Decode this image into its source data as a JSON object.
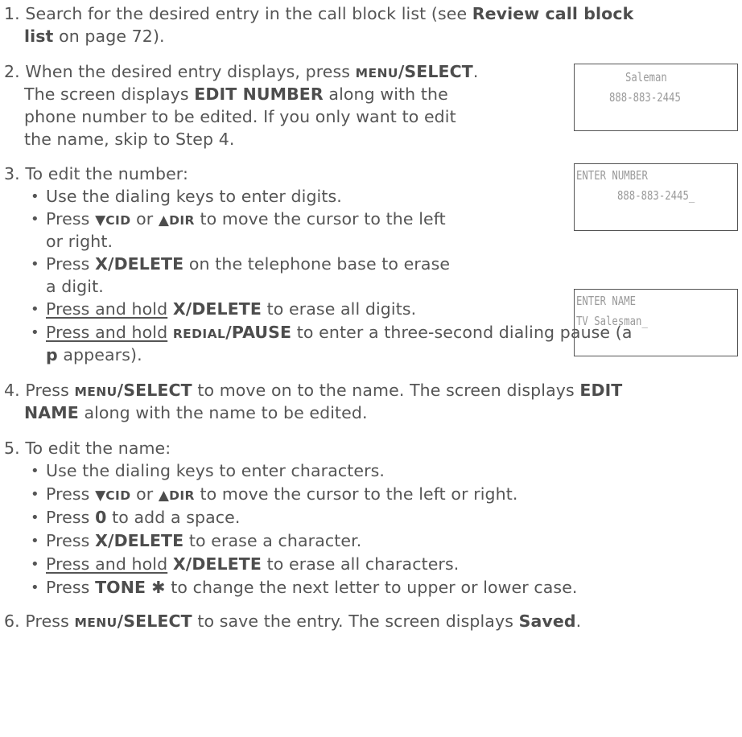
{
  "steps": {
    "s1": {
      "num": "1.",
      "l1a": "Search for the desired entry in the call block list (see ",
      "l1b": "Review call block",
      "l2a": "list",
      "l2b": " on page 72)."
    },
    "s2": {
      "num": "2.",
      "l1a": "When the desired entry displays, press ",
      "key": "MENU",
      "l1b": "/SELECT",
      "l1c": ".",
      "l2": "The screen displays ",
      "l2b": "EDIT NUMBER",
      "l2c": " along with the",
      "l3": "phone number to be edited. If you only want to edit",
      "l4": "the name, skip to Step 4."
    },
    "s3": {
      "num": "3.",
      "intro": "To edit the number:",
      "b1": "Use the dialing keys to enter digits.",
      "b2a": "Press ",
      "b2_down": "▼",
      "b2_cid": "CID",
      "b2_or": " or ",
      "b2_up": "▲",
      "b2_dir": "DIR",
      "b2b": " to move the cursor to the left",
      "b2c": "or right.",
      "b3a": "Press ",
      "b3b": "X/DELETE",
      "b3c": " on the telephone base to erase",
      "b3d": "a digit.",
      "b4a": "Press and hold",
      "b4b": " ",
      "b4c": "X/DELETE",
      "b4d": " to erase all digits.",
      "b5a": "Press and hold",
      "b5b": " ",
      "b5c": "REDIAL",
      "b5d": "/PAUSE",
      "b5e": " to enter a three-second dialing pause (a",
      "b5f": "p",
      "b5g": " appears)."
    },
    "s4": {
      "num": "4.",
      "l1a": "Press ",
      "key": "MENU",
      "l1b": "/SELECT",
      "l1c": " to move on to the name. The screen displays ",
      "l1d": "EDIT",
      "l2a": "NAME",
      "l2b": " along with the name to be edited."
    },
    "s5": {
      "num": "5.",
      "intro": "To edit the name:",
      "b1": "Use the dialing keys to enter characters.",
      "b2a": "Press ",
      "b2_down": "▼",
      "b2_cid": "CID",
      "b2_or": " or ",
      "b2_up": "▲",
      "b2_dir": "DIR",
      "b2b": " to move the cursor to the left or right.",
      "b3a": "Press ",
      "b3b": "0",
      "b3c": " to add a space.",
      "b4a": "Press ",
      "b4b": "X/DELETE",
      "b4c": " to erase a character.",
      "b5a": "Press and hold",
      "b5b": " ",
      "b5c": "X/DELETE",
      "b5d": " to erase all characters.",
      "b6a": "Press ",
      "b6b": "TONE ",
      "b6c": "✱",
      "b6d": " to change the next letter to upper or lower case."
    },
    "s6": {
      "num": "6.",
      "l1a": "Press ",
      "key": "MENU",
      "l1b": "/SELECT",
      "l1c": " to save the entry. The screen displays ",
      "l1d": "Saved",
      "l1e": "."
    }
  },
  "screens": [
    {
      "line1": "Saleman",
      "line2": "888-883-2445"
    },
    {
      "line1": "ENTER NUMBER",
      "line2": "888-883-2445_"
    },
    {
      "line1": "ENTER NAME",
      "line2": "TV Salesman_"
    }
  ],
  "bullet_glyph": "•"
}
